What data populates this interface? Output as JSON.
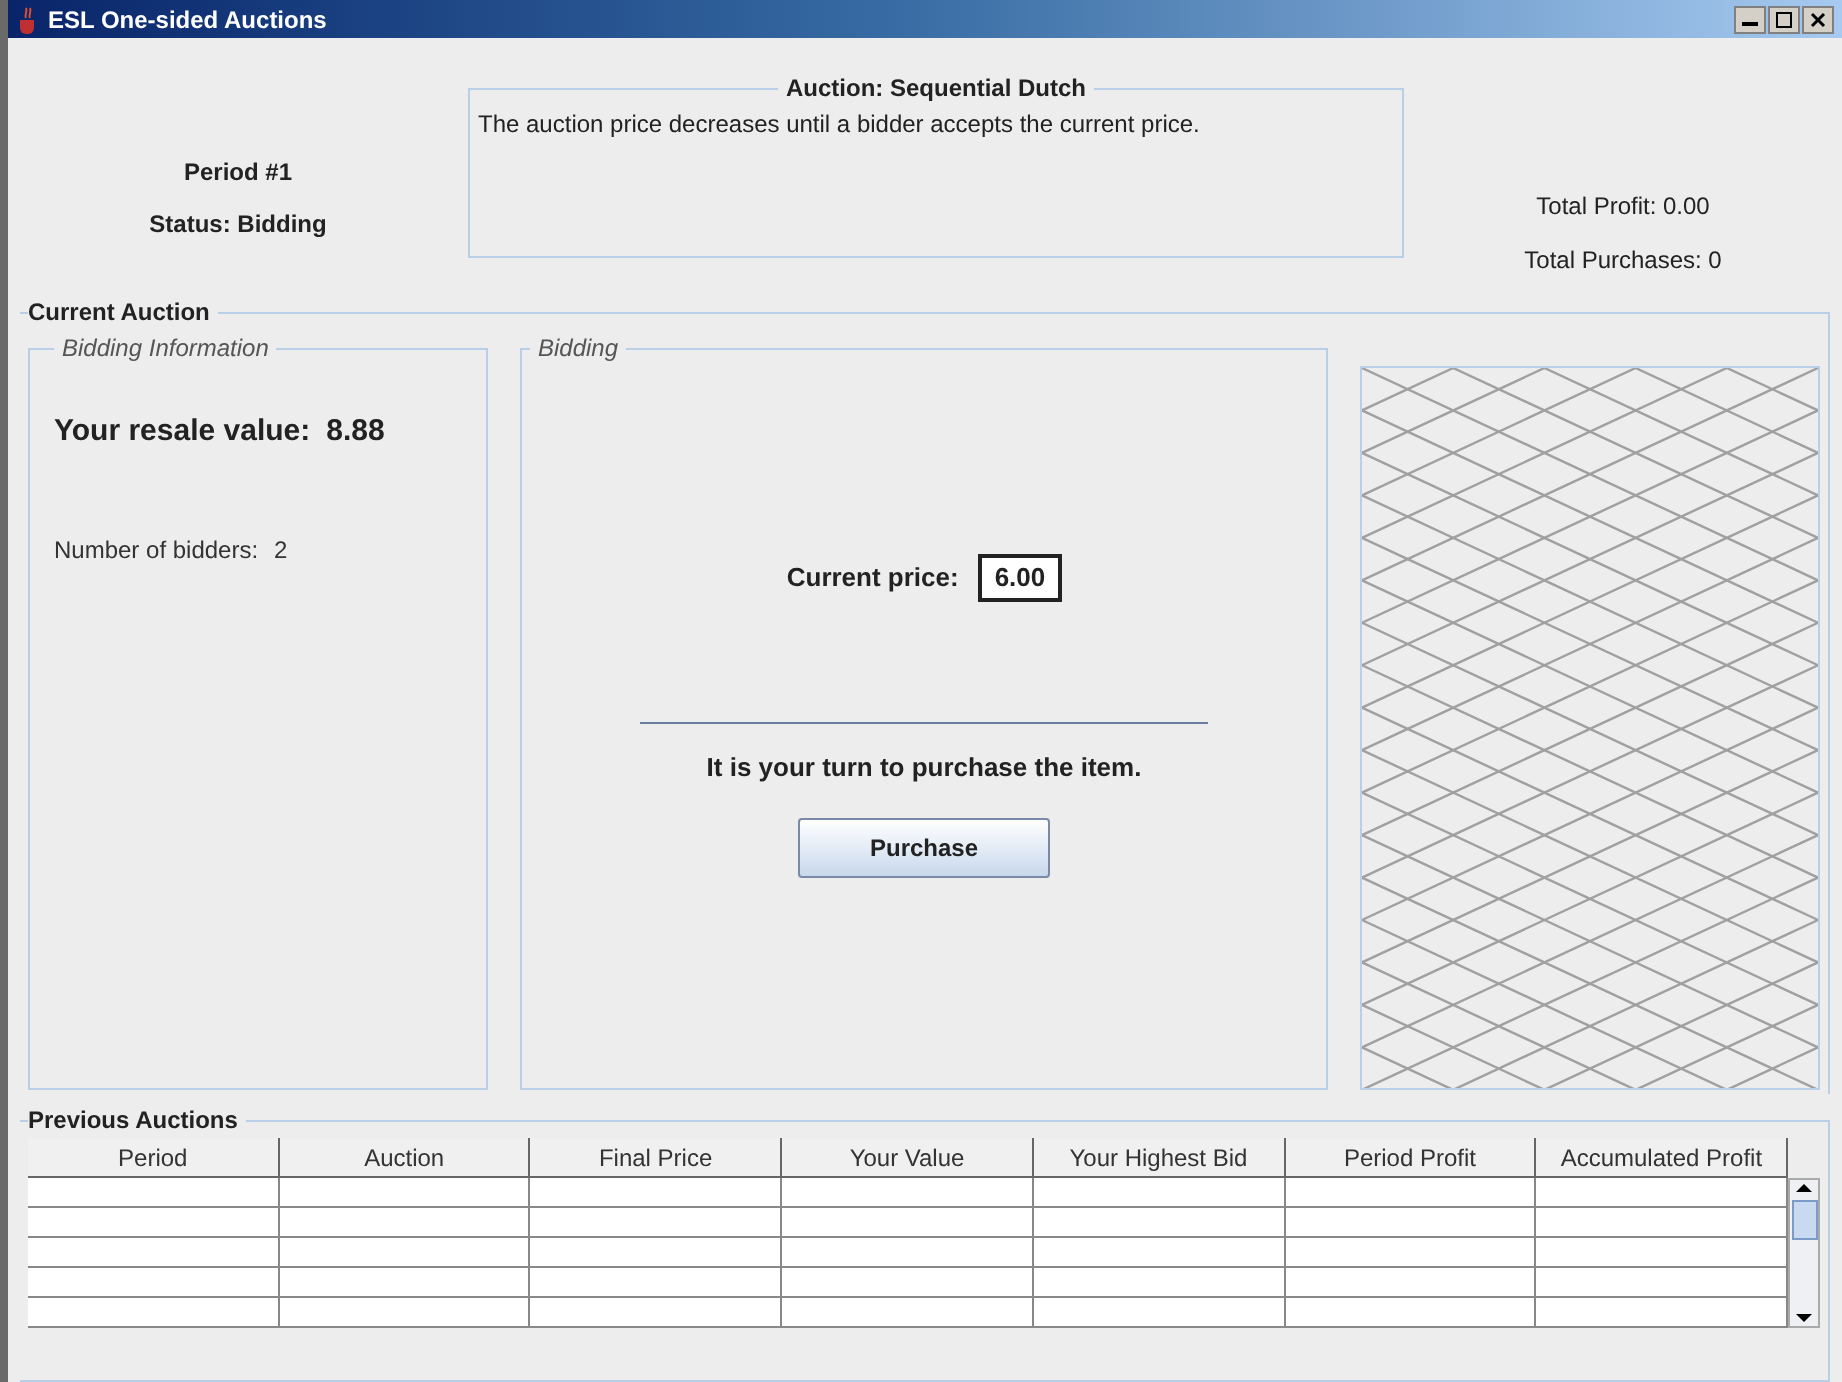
{
  "window": {
    "title": "ESL One-sided Auctions"
  },
  "header": {
    "period": "Period #1",
    "status": "Status: Bidding",
    "auction_title": "Auction: Sequential Dutch",
    "auction_description": "The auction price decreases until a bidder accepts the current price.",
    "total_profit": "Total Profit: 0.00",
    "total_purchases": "Total Purchases: 0"
  },
  "current_auction": {
    "title": "Current Auction",
    "bidding_information": {
      "title": "Bidding Information",
      "resale_label": "Your resale value:",
      "resale_value": "8.88",
      "bidders_label": "Number of bidders:",
      "bidders_value": "2"
    },
    "bidding": {
      "title": "Bidding",
      "price_label": "Current price:",
      "price_value": "6.00",
      "message": "It is your turn to purchase the item.",
      "button": "Purchase"
    }
  },
  "previous_auctions": {
    "title": "Previous Auctions",
    "columns": [
      "Period",
      "Auction",
      "Final Price",
      "Your Value",
      "Your Highest Bid",
      "Period Profit",
      "Accumulated Profit"
    ]
  }
}
